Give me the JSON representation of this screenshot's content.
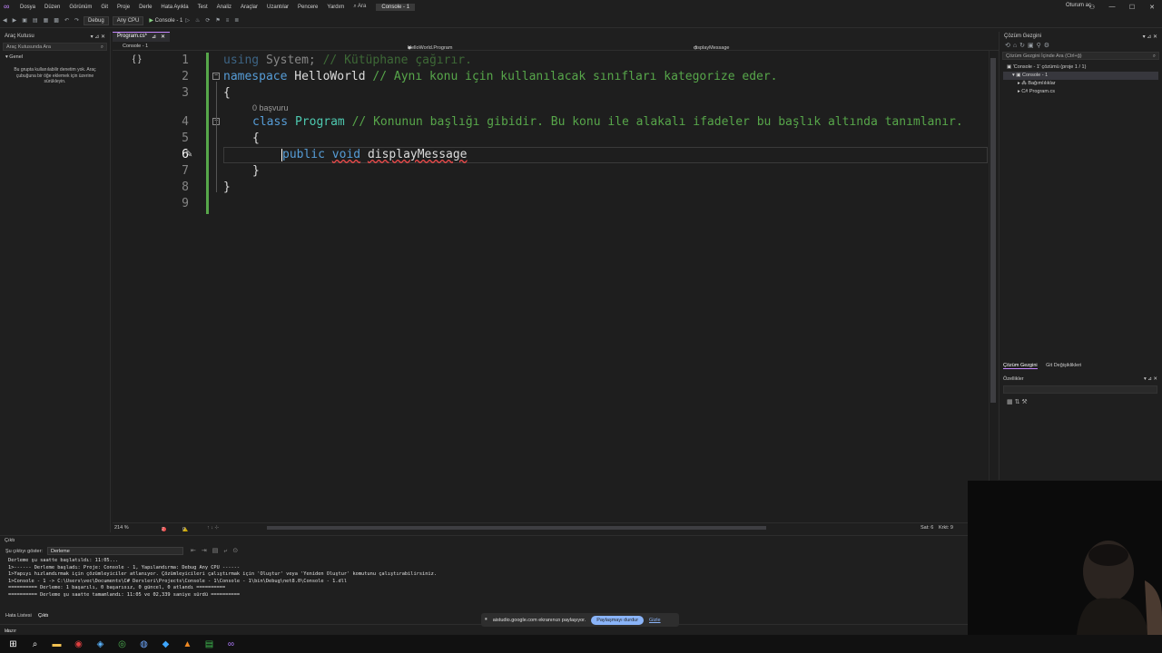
{
  "menubar": {
    "items": [
      "Dosya",
      "Düzen",
      "Görünüm",
      "Git",
      "Proje",
      "Derle",
      "Hata Ayıkla",
      "Test",
      "Analiz",
      "Araçlar",
      "Uzantılar",
      "Pencere",
      "Yardım"
    ],
    "search_label": "Ara",
    "project_title": "Console - 1",
    "signin_label": "Oturum aç"
  },
  "toolbar": {
    "config": "Debug",
    "platform": "Any CPU",
    "run_label": "Console - 1"
  },
  "toolbox": {
    "title": "Araç Kutusu",
    "search_placeholder": "Araç Kutusunda Ara",
    "group_label": "Genel",
    "empty_message": "Bu grupta kullanılabilir denetim yok. Araç çubuğuna bir öğe eklemek için üzerine sürükleyin."
  },
  "editor": {
    "tab_label": "Program.cs*",
    "nav_project": "Console - 1",
    "nav_class": "HelloWorld.Program",
    "nav_member": "displayMessage",
    "codelens": "0 başvuru",
    "line_numbers": [
      "1",
      "2",
      "3",
      "4",
      "5",
      "6",
      "7",
      "8",
      "9"
    ],
    "code": {
      "l1_kw": "using",
      "l1_ns": "System;",
      "l1_cm": "// Kütüphane çağırır.",
      "l2_kw": "namespace",
      "l2_name": "HelloWorld",
      "l2_cm": "// Aynı konu için kullanılacak sınıfları kategorize eder.",
      "l3": "{",
      "l4_kw": "class",
      "l4_name": "Program",
      "l4_cm": "// Konunun başlığı gibidir. Bu konu ile alakalı ifadeler bu başlık altında tanımlanır.",
      "l5": "{",
      "l6_kw1": "public",
      "l6_kw2": "void",
      "l6_name": "displayMessage",
      "l7": "}",
      "l8": "}"
    },
    "status": {
      "zoom": "214 %",
      "errors": "2",
      "warnings": "0",
      "position": "Sat: 6",
      "char": "Krkt: 9"
    }
  },
  "solution_explorer": {
    "title": "Çözüm Gezgini",
    "search_placeholder": "Çözüm Gezgini İçinde Ara (Ctrl+ğ)",
    "tree": [
      "'Console - 1' çözümü (proje 1 / 1)",
      "Console - 1",
      "Bağımlılıklar",
      "Program.cs"
    ],
    "tabs": [
      "Çözüm Gezgini",
      "Git Değişiklikleri"
    ]
  },
  "properties": {
    "title": "Özellikler"
  },
  "output": {
    "title": "Çıktı",
    "source_label": "Şu çıktıyı göster:",
    "source_value": "Derleme",
    "lines": [
      "Derleme şu saatte başlatıldı: 11:05...",
      "1>------ Derleme başladı: Proje: Console - 1, Yapılandırma: Debug Any CPU ------",
      "1>Yapıyı hızlandırmak için çözümleyiciler atlanıyor. Çözümleyicileri çalıştırmak için 'Oluştur' veya 'Yeniden Oluştur' komutunu çalıştırabilirsiniz.",
      "1>Console - 1 -> C:\\Users\\vec\\Documents\\C# Dersleri\\Projects\\Console - 1\\Console - 1\\bin\\Debug\\net8.0\\Console - 1.dll",
      "========== Derleme: 1 başarılı, 0 başarısız, 0 güncel, 0 atlandı ==========",
      "========== Derleme şu saatte tamamlandı: 11:05 ve 02,339 saniye sürdü =========="
    ]
  },
  "bottom_tabs": [
    "Hata Listesi",
    "Çıktı"
  ],
  "statusbar": {
    "ready": "Hazır"
  },
  "share_banner": {
    "text": "aistudio.google.com ekranınızı paylaşıyor.",
    "stop_label": "Paylaşmayı durdur",
    "hide_label": "Gizle"
  },
  "colors": {
    "keyword": "#569cd6",
    "type": "#4ec9b0",
    "comment": "#57a64a",
    "accent": "#c586ff"
  }
}
